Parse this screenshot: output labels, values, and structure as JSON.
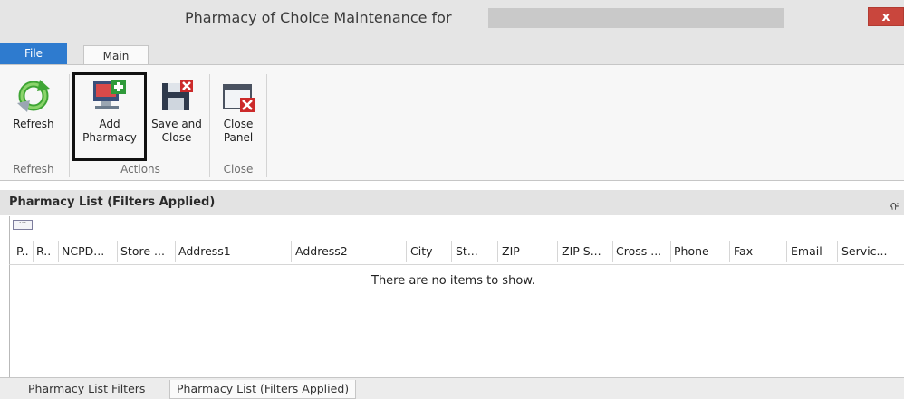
{
  "window": {
    "title": "Pharmacy of Choice Maintenance for",
    "close_label": "x"
  },
  "ribbon_tabs": {
    "file": "File",
    "main": "Main"
  },
  "ribbon": {
    "refresh": {
      "label1": "Refresh",
      "label2": "",
      "icon": "refresh-icon"
    },
    "add_pharmacy": {
      "label1": "Add",
      "label2": "Pharmacy",
      "icon": "add-pharmacy-icon"
    },
    "save_close": {
      "label1": "Save and",
      "label2": "Close",
      "icon": "save-close-icon"
    },
    "close_panel": {
      "label1": "Close",
      "label2": "Panel",
      "icon": "close-panel-icon"
    },
    "groups": {
      "refresh": "Refresh",
      "actions": "Actions",
      "close": "Close"
    }
  },
  "panel": {
    "title": "Pharmacy List (Filters Applied)",
    "pin_glyph": "ᡤ",
    "columns": [
      "P..",
      "R..",
      "NCPD...",
      "Store ...",
      "Address1",
      "Address2",
      "City",
      "St...",
      "ZIP",
      "ZIP S...",
      "Cross ...",
      "Phone",
      "Fax",
      "Email",
      "Servic..."
    ],
    "empty_message": "There are no items to show."
  },
  "bottom_tabs": [
    "Pharmacy List Filters",
    "Pharmacy List (Filters Applied)"
  ],
  "colors": {
    "file_tab": "#2e7bcf",
    "close_button": "#c9463d"
  }
}
